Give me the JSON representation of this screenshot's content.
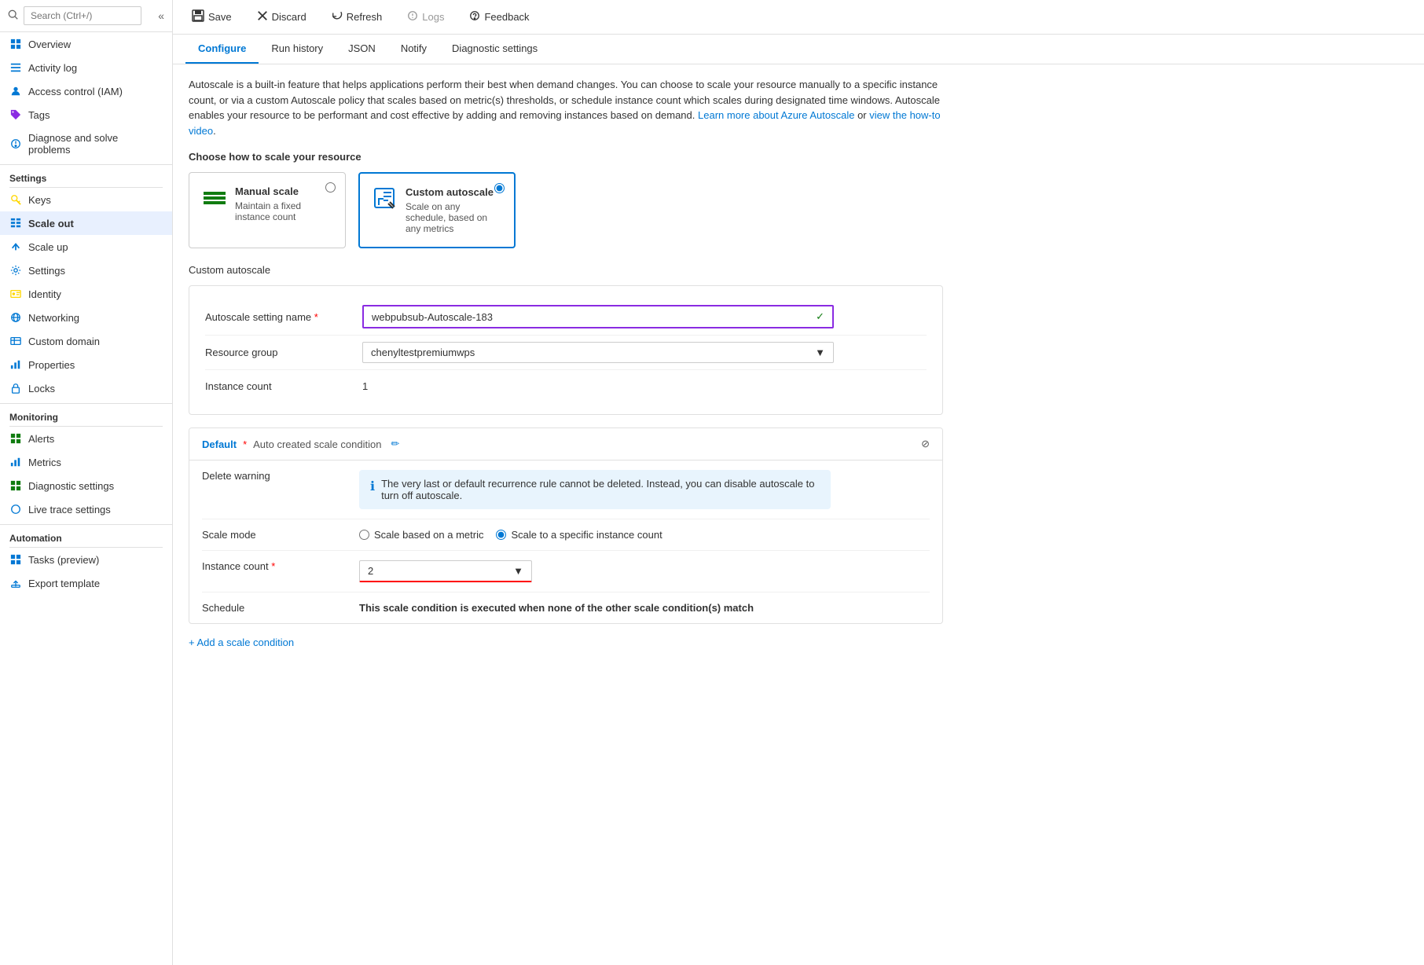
{
  "sidebar": {
    "search_placeholder": "Search (Ctrl+/)",
    "collapse_icon": "«",
    "nav_items": [
      {
        "id": "overview",
        "label": "Overview",
        "icon": "grid",
        "active": false
      },
      {
        "id": "activity-log",
        "label": "Activity log",
        "icon": "list",
        "active": false
      },
      {
        "id": "access-control",
        "label": "Access control (IAM)",
        "icon": "person",
        "active": false
      },
      {
        "id": "tags",
        "label": "Tags",
        "icon": "tag",
        "active": false
      },
      {
        "id": "diagnose",
        "label": "Diagnose and solve problems",
        "icon": "wrench",
        "active": false
      }
    ],
    "settings_section": "Settings",
    "settings_items": [
      {
        "id": "keys",
        "label": "Keys",
        "icon": "key",
        "active": false
      },
      {
        "id": "scale-out",
        "label": "Scale out",
        "icon": "table",
        "active": true
      },
      {
        "id": "scale-up",
        "label": "Scale up",
        "icon": "arrow-up",
        "active": false
      },
      {
        "id": "settings",
        "label": "Settings",
        "icon": "gear",
        "active": false
      },
      {
        "id": "identity",
        "label": "Identity",
        "icon": "id-card",
        "active": false
      },
      {
        "id": "networking",
        "label": "Networking",
        "icon": "globe",
        "active": false
      },
      {
        "id": "custom-domain",
        "label": "Custom domain",
        "icon": "domain",
        "active": false
      },
      {
        "id": "properties",
        "label": "Properties",
        "icon": "chart-bar",
        "active": false
      },
      {
        "id": "locks",
        "label": "Locks",
        "icon": "lock",
        "active": false
      }
    ],
    "monitoring_section": "Monitoring",
    "monitoring_items": [
      {
        "id": "alerts",
        "label": "Alerts",
        "icon": "alert",
        "active": false
      },
      {
        "id": "metrics",
        "label": "Metrics",
        "icon": "metrics",
        "active": false
      },
      {
        "id": "diagnostic-settings",
        "label": "Diagnostic settings",
        "icon": "diagnostic",
        "active": false
      },
      {
        "id": "live-trace",
        "label": "Live trace settings",
        "icon": "circle",
        "active": false
      }
    ],
    "automation_section": "Automation",
    "automation_items": [
      {
        "id": "tasks",
        "label": "Tasks (preview)",
        "icon": "tasks",
        "active": false
      },
      {
        "id": "export-template",
        "label": "Export template",
        "icon": "export",
        "active": false
      }
    ]
  },
  "toolbar": {
    "save_label": "Save",
    "discard_label": "Discard",
    "refresh_label": "Refresh",
    "logs_label": "Logs",
    "feedback_label": "Feedback"
  },
  "tabs": {
    "items": [
      {
        "id": "configure",
        "label": "Configure",
        "active": true
      },
      {
        "id": "run-history",
        "label": "Run history",
        "active": false
      },
      {
        "id": "json",
        "label": "JSON",
        "active": false
      },
      {
        "id": "notify",
        "label": "Notify",
        "active": false
      },
      {
        "id": "diagnostic-settings",
        "label": "Diagnostic settings",
        "active": false
      }
    ]
  },
  "description": {
    "text1": "Autoscale is a built-in feature that helps applications perform their best when demand changes. You can choose to scale your resource manually to a specific instance count, or via a custom Autoscale policy that scales based on metric(s) thresholds, or schedule instance count which scales during designated time windows. Autoscale enables your resource to be performant and cost effective by adding and removing instances based on demand. ",
    "link1_text": "Learn more about Azure Autoscale",
    "link1_url": "#",
    "text2": " or ",
    "link2_text": "view the how-to video",
    "link2_url": "#",
    "text3": "."
  },
  "scale": {
    "section_title": "Choose how to scale your resource",
    "manual_title": "Manual scale",
    "manual_desc": "Maintain a fixed instance count",
    "custom_title": "Custom autoscale",
    "custom_desc": "Scale on any schedule, based on any metrics",
    "selected": "custom"
  },
  "form": {
    "autoscale_name_label": "Autoscale setting name",
    "autoscale_name_required": "*",
    "autoscale_name_value": "webpubsub-Autoscale-183",
    "resource_group_label": "Resource group",
    "resource_group_value": "chenyltestpremiumwps",
    "instance_count_label": "Instance count",
    "instance_count_value": "1"
  },
  "condition": {
    "default_label": "Default",
    "required_mark": "*",
    "auto_created_text": "Auto created scale condition",
    "edit_icon": "✏",
    "delete_icon": "⊘",
    "delete_warning_label": "Delete warning",
    "warning_text": "The very last or default recurrence rule cannot be deleted. Instead, you can disable autoscale to turn off autoscale.",
    "scale_mode_label": "Scale mode",
    "scale_metric_option": "Scale based on a metric",
    "scale_instance_option": "Scale to a specific instance count",
    "instance_count_label": "Instance count",
    "instance_count_required": "*",
    "instance_count_value": "2",
    "schedule_label": "Schedule",
    "schedule_text": "This scale condition is executed when none of the other scale condition(s) match",
    "add_condition_text": "+ Add a scale condition"
  }
}
